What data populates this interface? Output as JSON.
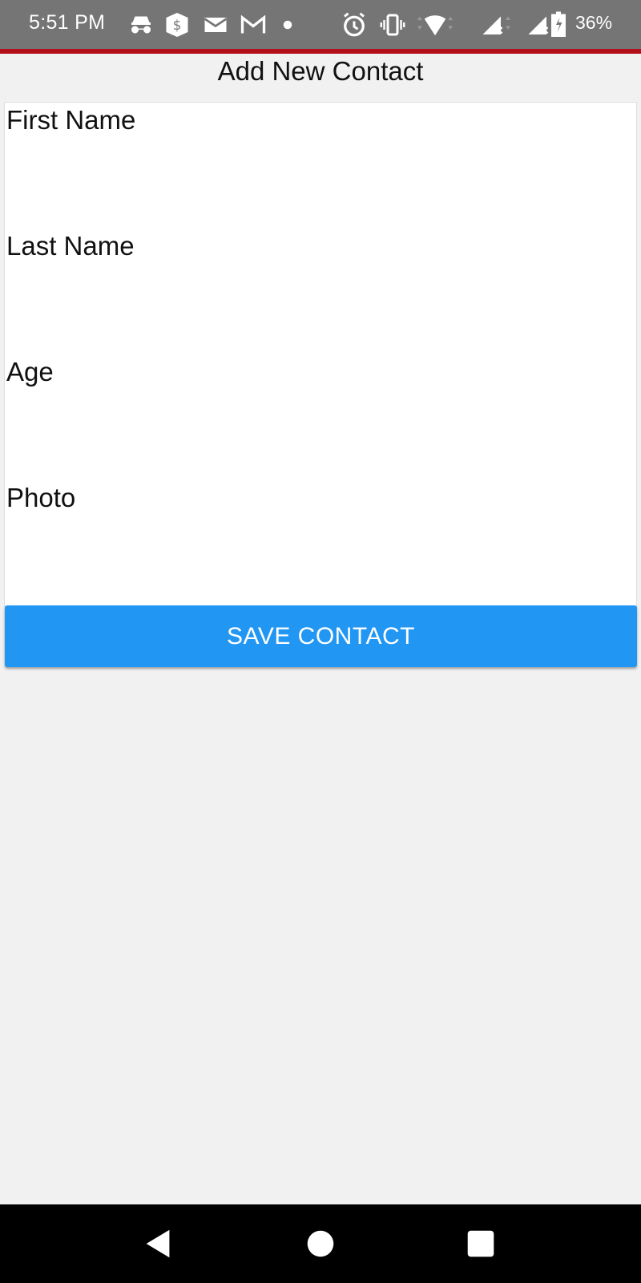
{
  "status_bar": {
    "time": "5:51 PM",
    "battery_percent": "36%",
    "icons": [
      "incognito-icon",
      "cash-app-icon",
      "mail-icon",
      "gmail-icon",
      "notification-dot-icon",
      "alarm-icon",
      "vibrate-icon",
      "wifi-icon",
      "signal-no-service-icon",
      "signal-no-service-icon",
      "battery-icon"
    ],
    "background_color": "#757575",
    "accent_color": "#b3101c"
  },
  "header": {
    "title": "Add New Contact"
  },
  "form": {
    "fields": [
      {
        "label": "First Name",
        "value": ""
      },
      {
        "label": "Last Name",
        "value": ""
      },
      {
        "label": "Age",
        "value": ""
      },
      {
        "label": "Photo",
        "value": ""
      }
    ]
  },
  "actions": {
    "save_label": "SAVE CONTACT",
    "save_color": "#2196f3"
  },
  "nav_bar": {
    "icons": [
      "back-icon",
      "home-icon",
      "recents-icon"
    ]
  }
}
